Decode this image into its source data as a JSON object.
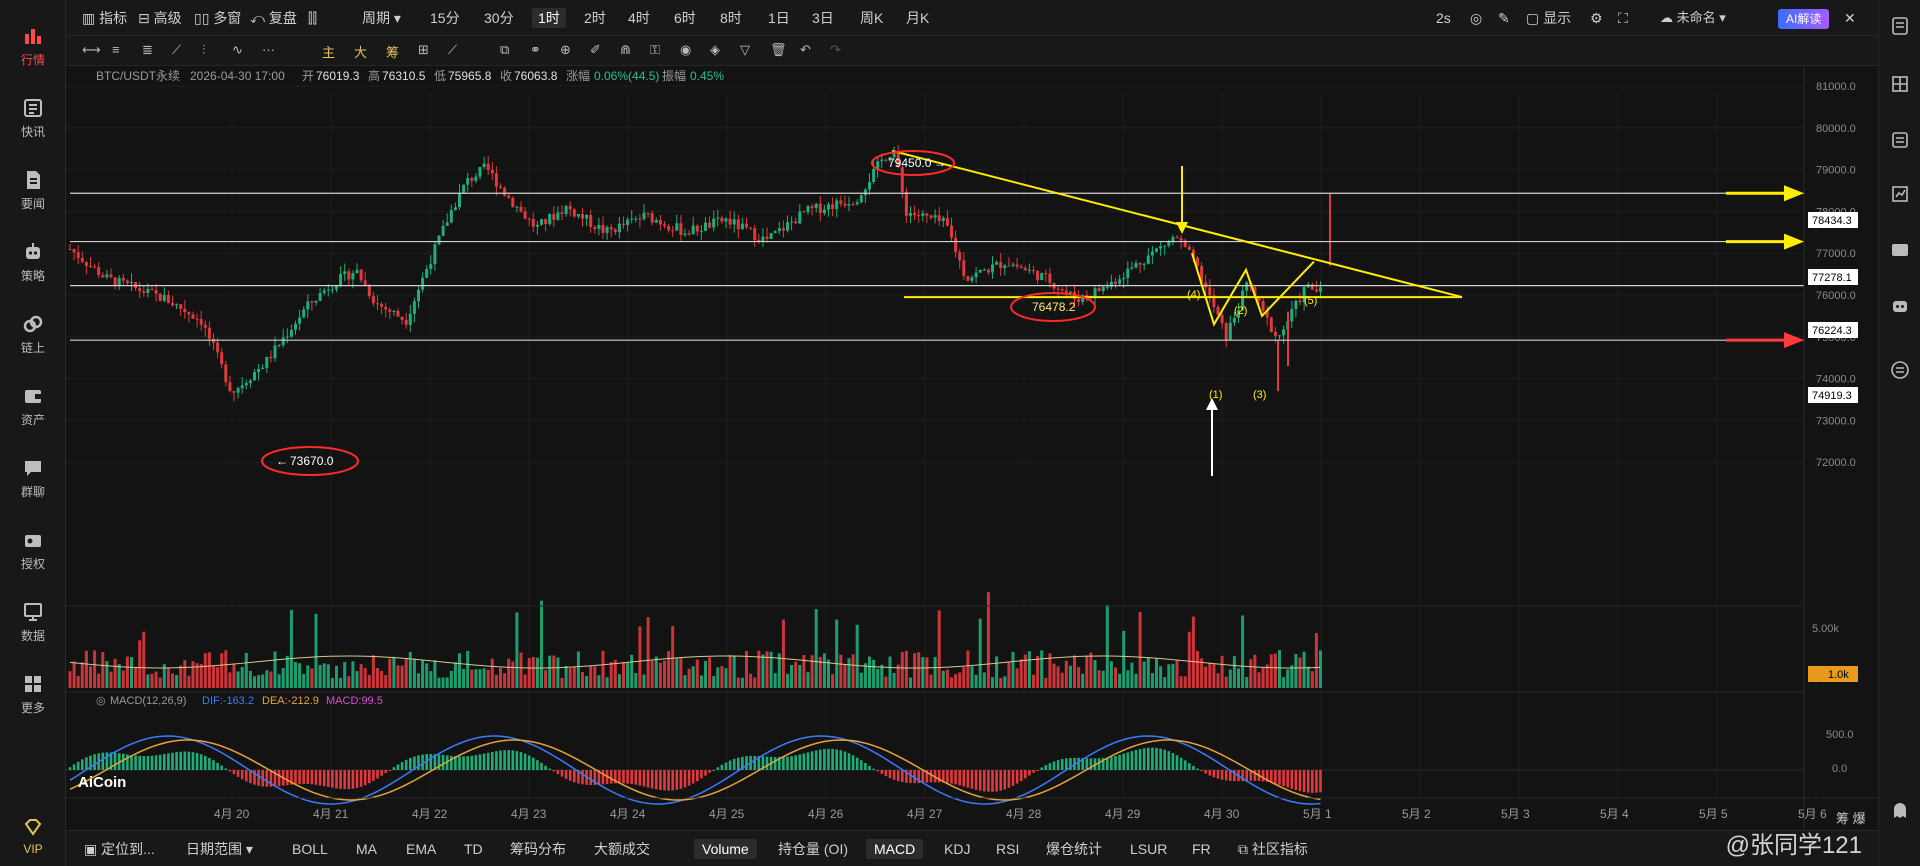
{
  "sidebar": {
    "items": [
      {
        "label": "行情",
        "icon": "bar-chart-icon",
        "active": true
      },
      {
        "label": "快讯",
        "icon": "news-icon"
      },
      {
        "label": "要闻",
        "icon": "document-icon"
      },
      {
        "label": "策略",
        "icon": "robot-icon"
      },
      {
        "label": "链上",
        "icon": "chain-icon"
      },
      {
        "label": "资产",
        "icon": "wallet-icon"
      },
      {
        "label": "群聊",
        "icon": "chat-icon"
      },
      {
        "label": "授权",
        "icon": "key-icon"
      },
      {
        "label": "数据",
        "icon": "monitor-icon"
      },
      {
        "label": "更多",
        "icon": "grid-icon"
      }
    ],
    "vip_label": "VIP"
  },
  "topbar": {
    "indicators": "指标",
    "advanced": "高级",
    "multi_window": "多窗",
    "replay": "复盘",
    "period_label": "周期",
    "intervals": [
      "15分",
      "30分",
      "1时",
      "2时",
      "4时",
      "6时",
      "8时",
      "1日",
      "3日",
      "周K",
      "月K"
    ],
    "active_interval": "1时",
    "refresh": "2s",
    "display": "显示",
    "layout_name": "未命名",
    "ai_button": "AI解读"
  },
  "ohlc": {
    "symbol": "BTC/USDT永续",
    "datetime": "2026-04-30 17:00",
    "open_label": "开",
    "open": "76019.3",
    "high_label": "高",
    "high": "76310.5",
    "low_label": "低",
    "low": "75965.8",
    "close_label": "收",
    "close": "76063.8",
    "change_label": "涨幅",
    "change": "0.06%(44.5)",
    "amplitude_label": "振幅",
    "amplitude": "0.45%"
  },
  "price_axis": [
    "81000.0",
    "80000.0",
    "79000.0",
    "78000.0",
    "77000.0",
    "76000.0",
    "75000.0",
    "74000.0",
    "73000.0",
    "72000.0"
  ],
  "price_tags": [
    {
      "value": "78434.3",
      "color": "#ffee00"
    },
    {
      "value": "77278.1",
      "color": "#ffee00"
    },
    {
      "value": "76224.3",
      "color": "#ffffff"
    },
    {
      "value": "74919.3",
      "color": "#ff3b3b"
    }
  ],
  "annotations": {
    "high_label": "79450.0",
    "mid_label": "76478.2",
    "low_label": "73670.0",
    "wave_labels": [
      "(4)",
      "(2)",
      "(5)",
      "(1)",
      "(3)"
    ]
  },
  "volume": {
    "axis_top": "5.00k",
    "current": "1.0k"
  },
  "macd": {
    "title": "MACD(12,26,9)",
    "dif": "DIF:-163.2",
    "dea": "DEA:-212.9",
    "macd": "MACD:99.5",
    "axis": [
      "500.0",
      "0.0"
    ]
  },
  "date_axis": [
    "4月 20",
    "4月 21",
    "4月 22",
    "4月 23",
    "4月 24",
    "4月 25",
    "4月 26",
    "4月 27",
    "4月 28",
    "4月 29",
    "4月 30",
    "5月 1",
    "5月 2",
    "5月 3",
    "5月 4",
    "5月 5",
    "5月 6"
  ],
  "logo": "AiCoin",
  "bottombar": {
    "locate": "定位到...",
    "date_range": "日期范围",
    "tabs": [
      "BOLL",
      "MA",
      "EMA",
      "TD",
      "筹码分布",
      "大额成交",
      "Volume",
      "持仓量 (OI)",
      "MACD",
      "KDJ",
      "RSI",
      "爆仓统计",
      "LSUR",
      "FR",
      "社区指标"
    ],
    "active_tabs": [
      "Volume",
      "MACD"
    ]
  },
  "watermark": "@张同学121",
  "right_corner": "筹 爆"
}
